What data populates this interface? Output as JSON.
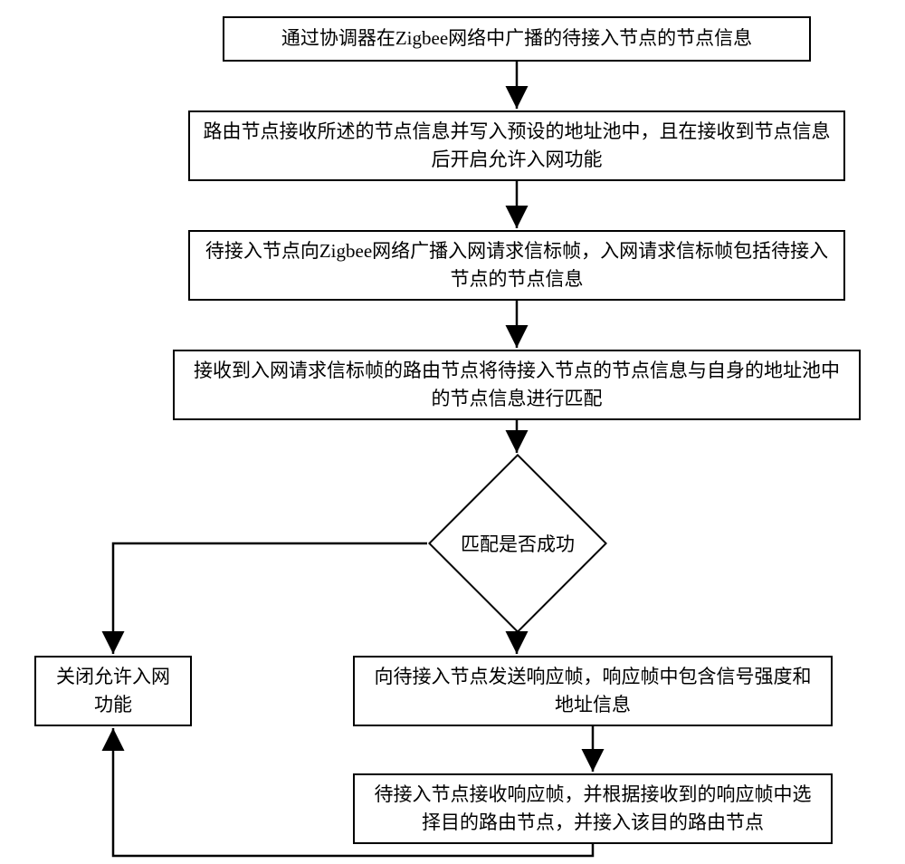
{
  "flowchart": {
    "step1": "通过协调器在Zigbee网络中广播的待接入节点的节点信息",
    "step2": "路由节点接收所述的节点信息并写入预设的地址池中，且在接收到节点信息后开启允许入网功能",
    "step3": "待接入节点向Zigbee网络广播入网请求信标帧，入网请求信标帧包括待接入节点的节点信息",
    "step4": "接收到入网请求信标帧的路由节点将待接入节点的节点信息与自身的地址池中的节点信息进行匹配",
    "decision": "匹配是否成功",
    "step5": "向待接入节点发送响应帧，响应帧中包含信号强度和地址信息",
    "step6": "待接入节点接收响应帧，并根据接收到的响应帧中选择目的路由节点，并接入该目的路由节点",
    "close": "关闭允许入网功能"
  }
}
